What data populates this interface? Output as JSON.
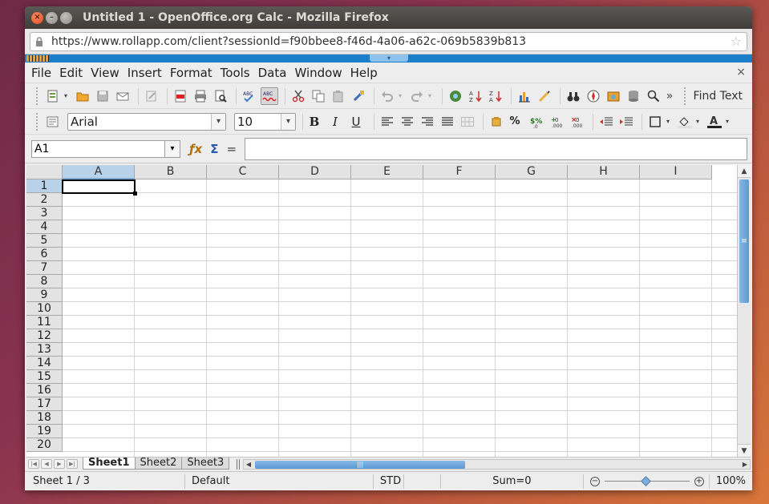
{
  "window": {
    "title": "Untitled 1 - OpenOffice.org Calc - Mozilla Firefox",
    "close_glyph": "×",
    "min_glyph": "–",
    "max_glyph": "□"
  },
  "browser": {
    "url": "https://www.rollapp.com/client?sessionId=f90bbee8-f46d-4a06-a62c-069b5839b813",
    "lock_icon": "lock-icon",
    "bookmark_icon": "star-icon"
  },
  "menu": {
    "items": [
      "File",
      "Edit",
      "View",
      "Insert",
      "Format",
      "Tools",
      "Data",
      "Window",
      "Help"
    ],
    "close_glyph": "×"
  },
  "standard_toolbar": {
    "find_text_label": "Find Text",
    "overflow_glyph": "»"
  },
  "formatting_toolbar": {
    "font_name": "Arial",
    "font_size": "10",
    "bold": "B",
    "italic": "I",
    "underline": "U",
    "percent": "%"
  },
  "formula_bar": {
    "name_box": "A1",
    "formula": "",
    "fx_glyph": "ƒx",
    "sum_glyph": "Σ",
    "equals_glyph": "="
  },
  "sheet": {
    "columns": [
      "A",
      "B",
      "C",
      "D",
      "E",
      "F",
      "G",
      "H",
      "I"
    ],
    "rows": [
      "1",
      "2",
      "3",
      "4",
      "5",
      "6",
      "7",
      "8",
      "9",
      "10",
      "11",
      "12",
      "13",
      "14",
      "15",
      "16",
      "17",
      "18",
      "19",
      "20"
    ],
    "active_cell": "A1",
    "tabs": [
      "Sheet1",
      "Sheet2",
      "Sheet3"
    ],
    "active_tab": "Sheet1"
  },
  "status": {
    "sheet_position": "Sheet 1 / 3",
    "page_style": "Default",
    "selection_mode": "STD",
    "sum": "Sum=0",
    "zoom": "100%",
    "zoom_level": 1.0
  },
  "colors": {
    "accent_blue": "#1a7ec9",
    "scroll_thumb": "#5d99d3",
    "title_bar": "#3e3d39"
  }
}
